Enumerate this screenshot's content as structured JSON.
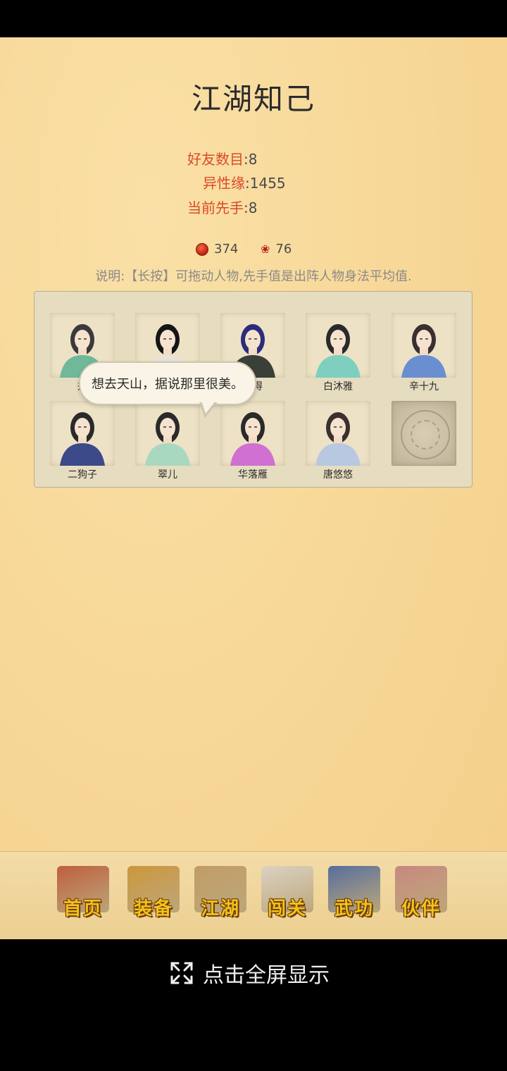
{
  "title": "江湖知己",
  "stats": {
    "friends_label": "好友数目",
    "friends_value": ":8",
    "charm_label": "异性缘",
    "charm_value": ":1455",
    "initiative_label": "当前先手",
    "initiative_value": ":8"
  },
  "currency": {
    "pot_icon": "red-pot-icon",
    "pot_value": "374",
    "rose_icon": "rose-icon",
    "rose_value": "76"
  },
  "note": "说明:【长按】可拖动人物,先手值是出阵人物身法平均值.",
  "partners": [
    {
      "name": "郑",
      "hair": "#3a3a3a",
      "robe": "#6fb89a"
    },
    {
      "name": "",
      "hair": "#151515",
      "robe": "#e8e2d8"
    },
    {
      "name": "觉得",
      "hair": "#2c2c7a",
      "robe": "#3a3f3a"
    },
    {
      "name": "白沐雅",
      "hair": "#2a2a2a",
      "robe": "#7fcfc0"
    },
    {
      "name": "辛十九",
      "hair": "#3a3030",
      "robe": "#6a8fd0"
    },
    {
      "name": "二狗子",
      "hair": "#2a2a2a",
      "robe": "#3c4a8a"
    },
    {
      "name": "翠儿",
      "hair": "#2a2a2a",
      "robe": "#a8d8c0"
    },
    {
      "name": "华落雁",
      "hair": "#2a2a2a",
      "robe": "#d070d0"
    },
    {
      "name": "唐悠悠",
      "hair": "#3a3030",
      "robe": "#b8c8e0"
    },
    {
      "name": ""
    }
  ],
  "speech_bubble": "想去天山，据说那里很美。",
  "nav": [
    {
      "label": "首页",
      "icon": "house-icon",
      "art": "#b5482a"
    },
    {
      "label": "装备",
      "icon": "armor-icon",
      "art": "#c58a2a"
    },
    {
      "label": "江湖",
      "icon": "scroll-map-icon",
      "art": "#b8915a"
    },
    {
      "label": "闯关",
      "icon": "crossed-swords-icon",
      "art": "#d8d0c8"
    },
    {
      "label": "武功",
      "icon": "book-icon",
      "art": "#3a5a9a"
    },
    {
      "label": "伙伴",
      "icon": "partners-icon",
      "art": "#c07a78"
    }
  ],
  "fullscreen": {
    "label": "点击全屏显示",
    "icon": "expand-icon"
  },
  "colors": {
    "label_red": "#d94a2a",
    "nav_gold": "#f2c21a",
    "paper": "#f7d796"
  }
}
